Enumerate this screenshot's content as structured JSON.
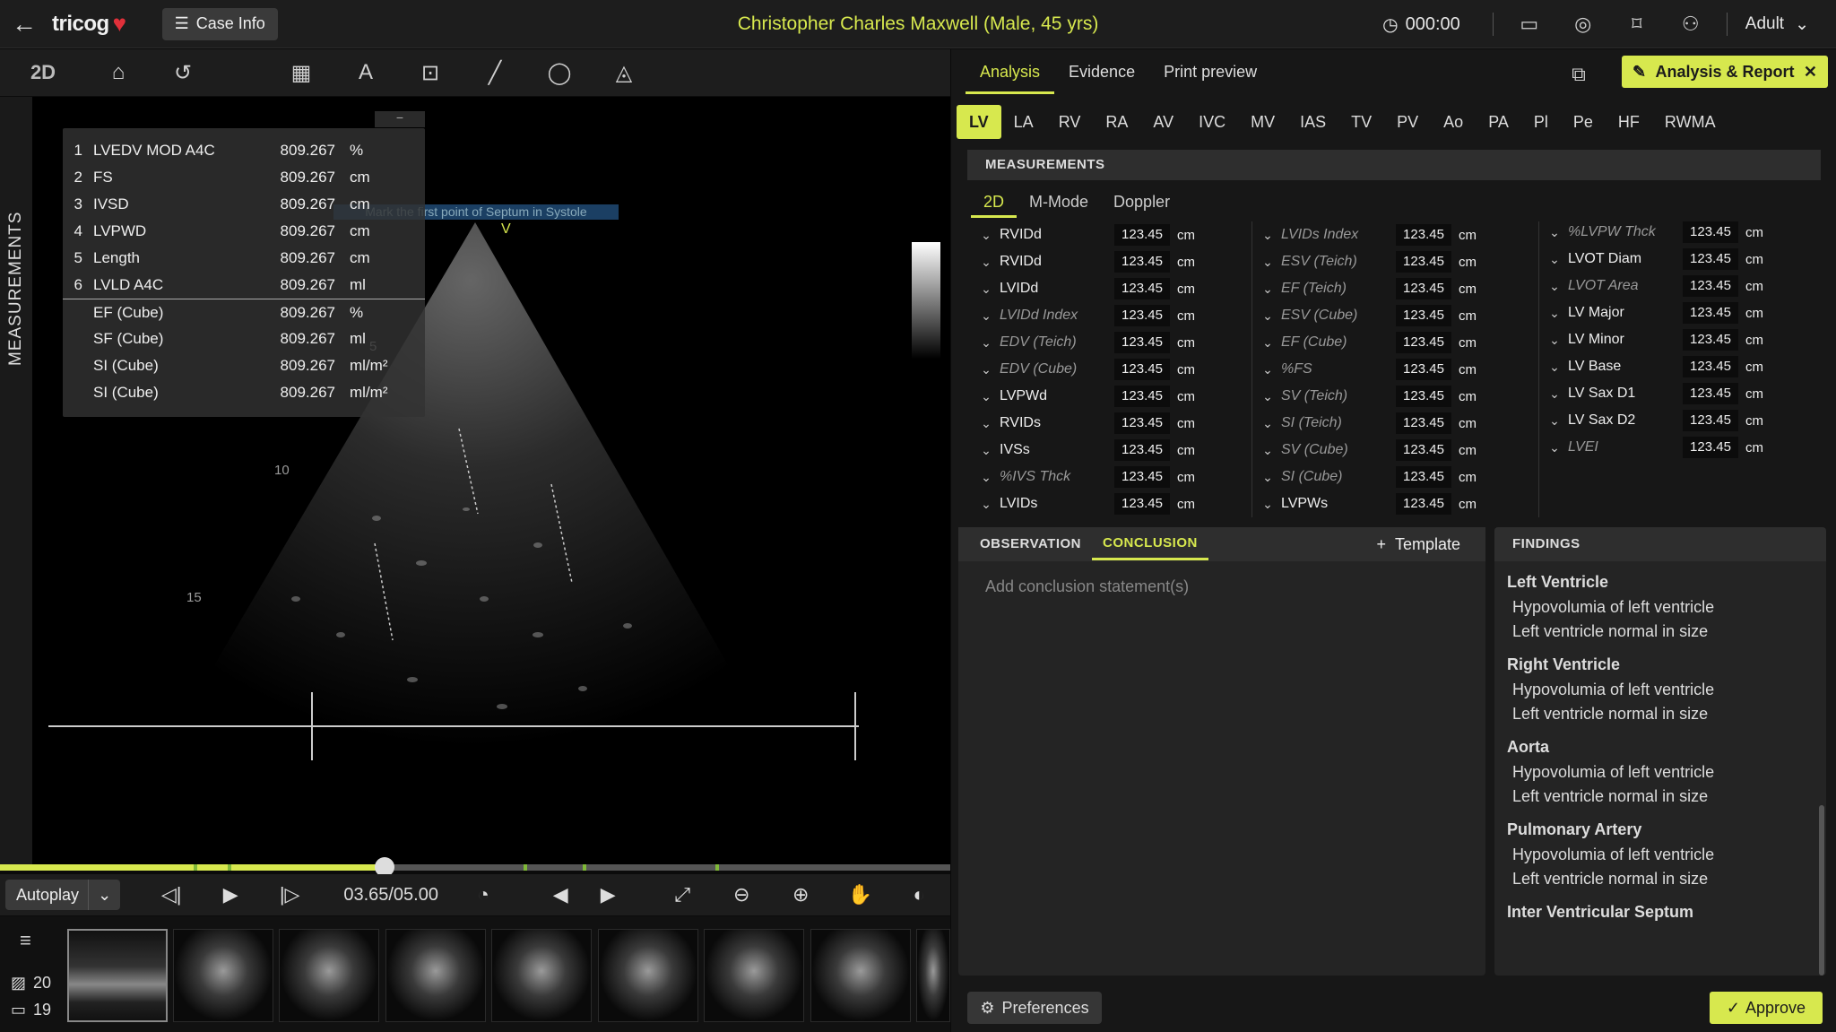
{
  "header": {
    "logo": "tricog",
    "case_info": "Case Info",
    "patient": "Christopher Charles Maxwell (Male, 45 yrs)",
    "timer": "000:00",
    "profile": "Adult"
  },
  "toolbar": {
    "mode": "2D"
  },
  "viewer": {
    "side_label": "MEASUREMENTS",
    "hint": "Mark the first point of Septum in Systole",
    "marker": "V",
    "depth_labels": [
      "5",
      "10",
      "15"
    ],
    "measurements": [
      {
        "n": "1",
        "name": "LVEDV MOD A4C",
        "value": "809.267",
        "unit": "%"
      },
      {
        "n": "2",
        "name": "FS",
        "value": "809.267",
        "unit": "cm"
      },
      {
        "n": "3",
        "name": "IVSD",
        "value": "809.267",
        "unit": "cm"
      },
      {
        "n": "4",
        "name": "LVPWD",
        "value": "809.267",
        "unit": "cm"
      },
      {
        "n": "5",
        "name": "Length",
        "value": "809.267",
        "unit": "cm"
      },
      {
        "n": "6",
        "name": "LVLD A4C",
        "value": "809.267",
        "unit": "ml"
      },
      {
        "n": "",
        "name": "EF (Cube)",
        "value": "809.267",
        "unit": "%"
      },
      {
        "n": "",
        "name": "SF (Cube)",
        "value": "809.267",
        "unit": "ml"
      },
      {
        "n": "",
        "name": "SI (Cube)",
        "value": "809.267",
        "unit": "ml/m²"
      },
      {
        "n": "",
        "name": "SI (Cube)",
        "value": "809.267",
        "unit": "ml/m²"
      }
    ]
  },
  "playback": {
    "autoplay": "Autoplay",
    "time": "03.65/05.00",
    "progress": 0.405,
    "image_count": "20",
    "video_count": "19"
  },
  "panel": {
    "tabs": [
      "Analysis",
      "Evidence",
      "Print preview"
    ],
    "report_button": "Analysis & Report",
    "chips": [
      "LV",
      "LA",
      "RV",
      "RA",
      "AV",
      "IVC",
      "MV",
      "IAS",
      "TV",
      "PV",
      "Ao",
      "PA",
      "Pl",
      "Pe",
      "HF",
      "RWMA"
    ],
    "measurements_title": "MEASUREMENTS",
    "subtabs": [
      "2D",
      "M-Mode",
      "Doppler"
    ],
    "col1": [
      {
        "name": "RVIDd",
        "value": "123.45",
        "unit": "cm",
        "italic": false
      },
      {
        "name": "RVIDd",
        "value": "123.45",
        "unit": "cm",
        "italic": false
      },
      {
        "name": "LVIDd",
        "value": "123.45",
        "unit": "cm",
        "italic": false
      },
      {
        "name": "LVIDd Index",
        "value": "123.45",
        "unit": "cm",
        "italic": true
      },
      {
        "name": "EDV (Teich)",
        "value": "123.45",
        "unit": "cm",
        "italic": true
      },
      {
        "name": "EDV (Cube)",
        "value": "123.45",
        "unit": "cm",
        "italic": true
      },
      {
        "name": "LVPWd",
        "value": "123.45",
        "unit": "cm",
        "italic": false
      },
      {
        "name": "RVIDs",
        "value": "123.45",
        "unit": "cm",
        "italic": false
      },
      {
        "name": "IVSs",
        "value": "123.45",
        "unit": "cm",
        "italic": false
      },
      {
        "name": "%IVS Thck",
        "value": "123.45",
        "unit": "cm",
        "italic": true
      },
      {
        "name": "LVIDs",
        "value": "123.45",
        "unit": "cm",
        "italic": false
      }
    ],
    "col2": [
      {
        "name": "LVIDs Index",
        "value": "123.45",
        "unit": "cm",
        "italic": true
      },
      {
        "name": "ESV (Teich)",
        "value": "123.45",
        "unit": "cm",
        "italic": true
      },
      {
        "name": "EF (Teich)",
        "value": "123.45",
        "unit": "cm",
        "italic": true
      },
      {
        "name": "ESV (Cube)",
        "value": "123.45",
        "unit": "cm",
        "italic": true
      },
      {
        "name": "EF (Cube)",
        "value": "123.45",
        "unit": "cm",
        "italic": true
      },
      {
        "name": "%FS",
        "value": "123.45",
        "unit": "cm",
        "italic": true
      },
      {
        "name": "SV (Teich)",
        "value": "123.45",
        "unit": "cm",
        "italic": true
      },
      {
        "name": "SI (Teich)",
        "value": "123.45",
        "unit": "cm",
        "italic": true
      },
      {
        "name": "SV (Cube)",
        "value": "123.45",
        "unit": "cm",
        "italic": true
      },
      {
        "name": "SI (Cube)",
        "value": "123.45",
        "unit": "cm",
        "italic": true
      },
      {
        "name": "LVPWs",
        "value": "123.45",
        "unit": "cm",
        "italic": false
      }
    ],
    "col3": [
      {
        "name": "%LVPW Thck",
        "value": "123.45",
        "unit": "cm",
        "italic": true
      },
      {
        "name": "LVOT Diam",
        "value": "123.45",
        "unit": "cm",
        "italic": false
      },
      {
        "name": "LVOT Area",
        "value": "123.45",
        "unit": "cm",
        "italic": true
      },
      {
        "name": "LV Major",
        "value": "123.45",
        "unit": "cm",
        "italic": false
      },
      {
        "name": "LV Minor",
        "value": "123.45",
        "unit": "cm",
        "italic": false
      },
      {
        "name": "LV Base",
        "value": "123.45",
        "unit": "cm",
        "italic": false
      },
      {
        "name": "LV Sax D1",
        "value": "123.45",
        "unit": "cm",
        "italic": false
      },
      {
        "name": "LV Sax D2",
        "value": "123.45",
        "unit": "cm",
        "italic": false
      },
      {
        "name": "LVEI",
        "value": "123.45",
        "unit": "cm",
        "italic": true
      }
    ],
    "obs_tabs": [
      "OBSERVATION",
      "CONCLUSION"
    ],
    "template": "Template",
    "conclusion_placeholder": "Add conclusion statement(s)",
    "findings_title": "FINDINGS",
    "findings": [
      {
        "title": "Left Ventricle",
        "items": [
          "Hypovolumia of left ventricle",
          "Left ventricle normal in size"
        ]
      },
      {
        "title": "Right Ventricle",
        "items": [
          "Hypovolumia of left ventricle",
          "Left ventricle normal in size"
        ]
      },
      {
        "title": "Aorta",
        "items": [
          "Hypovolumia of left ventricle",
          "Left ventricle normal in size"
        ]
      },
      {
        "title": "Pulmonary Artery",
        "items": [
          "Hypovolumia of left ventricle",
          "Left ventricle normal in size"
        ]
      },
      {
        "title": "Inter Ventricular Septum",
        "items": []
      }
    ],
    "preferences": "Preferences",
    "approve": "Approve"
  },
  "colors": {
    "accent": "#d7e84e",
    "tick": "#7fb838"
  }
}
